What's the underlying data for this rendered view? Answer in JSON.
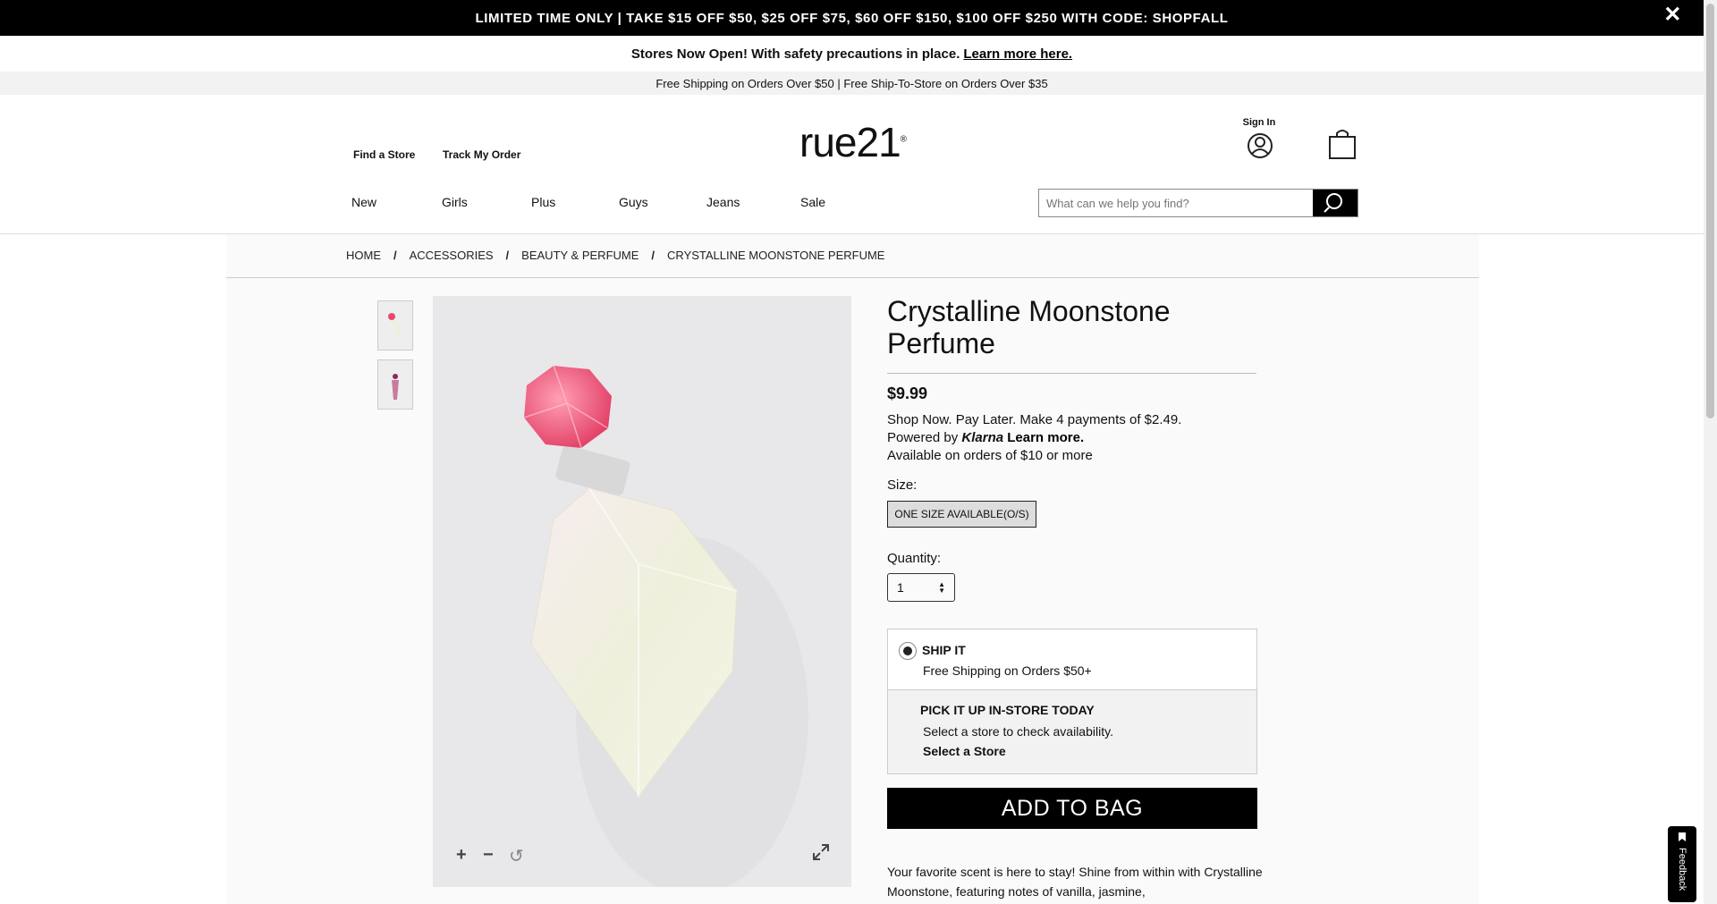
{
  "promo": {
    "text": "LIMITED TIME ONLY | TAKE $15 OFF $50, $25 OFF $75, $60 OFF $150, $100 OFF $250 WITH CODE: SHOPFALL",
    "close_glyph": "✕"
  },
  "stores_bar": {
    "text": "Stores Now Open! With safety precautions in place.",
    "link": "Learn more here."
  },
  "shipping_bar": {
    "text": "Free Shipping on Orders Over $50 | Free Ship-To-Store on Orders Over $35"
  },
  "header": {
    "find_store": "Find a Store",
    "track_order": "Track My Order",
    "logo": "rue21",
    "sign_in": "Sign In"
  },
  "nav": {
    "items": [
      {
        "label": "New"
      },
      {
        "label": "Girls"
      },
      {
        "label": "Plus"
      },
      {
        "label": "Guys"
      },
      {
        "label": "Jeans"
      },
      {
        "label": "Sale"
      }
    ]
  },
  "search": {
    "placeholder": "What can we help you find?"
  },
  "breadcrumb": {
    "items": [
      "HOME",
      "ACCESSORIES",
      "BEAUTY & PERFUME",
      "CRYSTALLINE MOONSTONE PERFUME"
    ],
    "separator": "/"
  },
  "product": {
    "title": "Crystalline Moonstone Perfume",
    "price": "$9.99",
    "klarna_line1": "Shop Now. Pay Later. Make 4 payments of $2.49. Powered by",
    "klarna_brand": "Klarna",
    "klarna_learn_more": "Learn more.",
    "klarna_line2": "Available on orders of $10 or more",
    "size_label": "Size:",
    "size_option": "ONE SIZE AVAILABLE(O/S)",
    "quantity_label": "Quantity:",
    "quantity_value": "1",
    "ship_title": "SHIP IT",
    "ship_sub": "Free Shipping on Orders $50+",
    "pickup_title": "PICK IT UP IN-STORE TODAY",
    "pickup_sub": "Select a store to check availability.",
    "pickup_link": "Select a Store",
    "add_to_bag": "ADD TO BAG",
    "description": "Your favorite scent is here to stay! Shine from within with Crystalline Moonstone, featuring notes of vanilla, jasmine,"
  },
  "image_controls": {
    "zoom_in": "+",
    "zoom_out": "−",
    "reset": "↺"
  },
  "feedback": {
    "label": "Feedback"
  }
}
